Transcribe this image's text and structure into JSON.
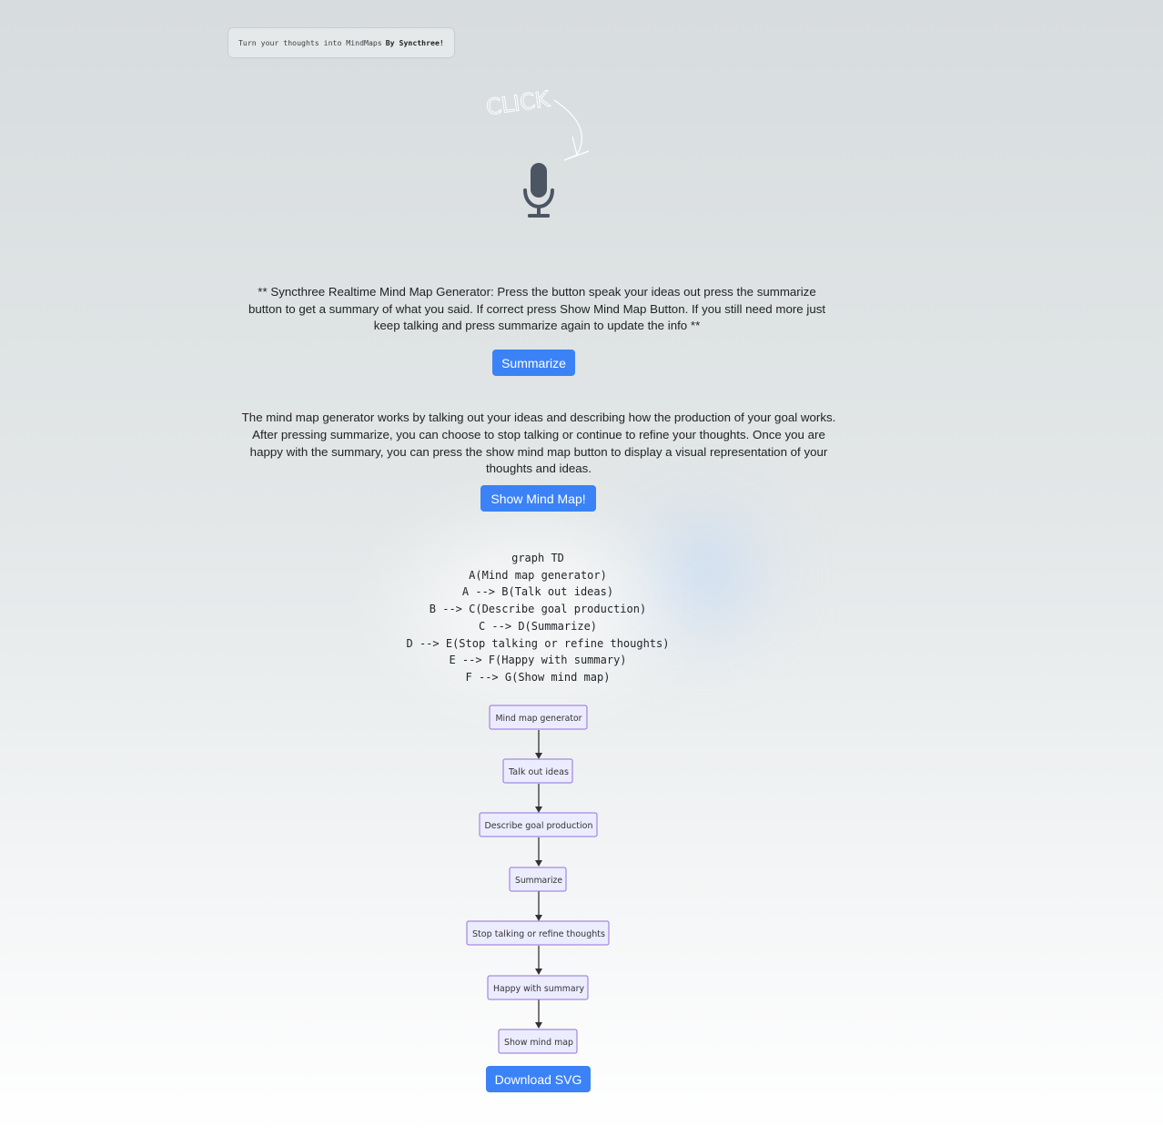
{
  "header": {
    "tagline_text": "Turn your thoughts into MindMaps",
    "tagline_brand": "By Syncthree!"
  },
  "record": {
    "hint_text": "CLICK",
    "mic_icon": "microphone-icon"
  },
  "intro": {
    "text": "** Syncthree Realtime Mind Map Generator: Press the button speak your ideas out press the summarize button to get a summary of what you said. If correct press Show Mind Map Button. If you still need more just keep talking and press summarize again to update the info **"
  },
  "buttons": {
    "summarize": "Summarize",
    "show_mind_map": "Show Mind Map!",
    "download_svg": "Download SVG"
  },
  "summary": {
    "text": "The mind map generator works by talking out your ideas and describing how the production of your goal works. After pressing summarize, you can choose to stop talking or continue to refine your thoughts. Once you are happy with the summary, you can press the show mind map button to display a visual representation of your thoughts and ideas."
  },
  "mermaid_code": [
    "graph TD",
    "A(Mind map generator)",
    "A --> B(Talk out ideas)",
    "B --> C(Describe goal production)",
    "C --> D(Summarize)",
    "D --> E(Stop talking or refine thoughts)",
    "E --> F(Happy with summary)",
    "F --> G(Show mind map)"
  ],
  "mindmap": {
    "nodes": [
      "Mind map generator",
      "Talk out ideas",
      "Describe goal production",
      "Summarize",
      "Stop talking or refine thoughts",
      "Happy with summary",
      "Show mind map"
    ],
    "node_fill": "#ececff",
    "node_stroke": "#9370db",
    "edge_color": "#333333"
  },
  "colors": {
    "button_blue": "#3b82f6",
    "mic_gray": "#4b5563"
  }
}
